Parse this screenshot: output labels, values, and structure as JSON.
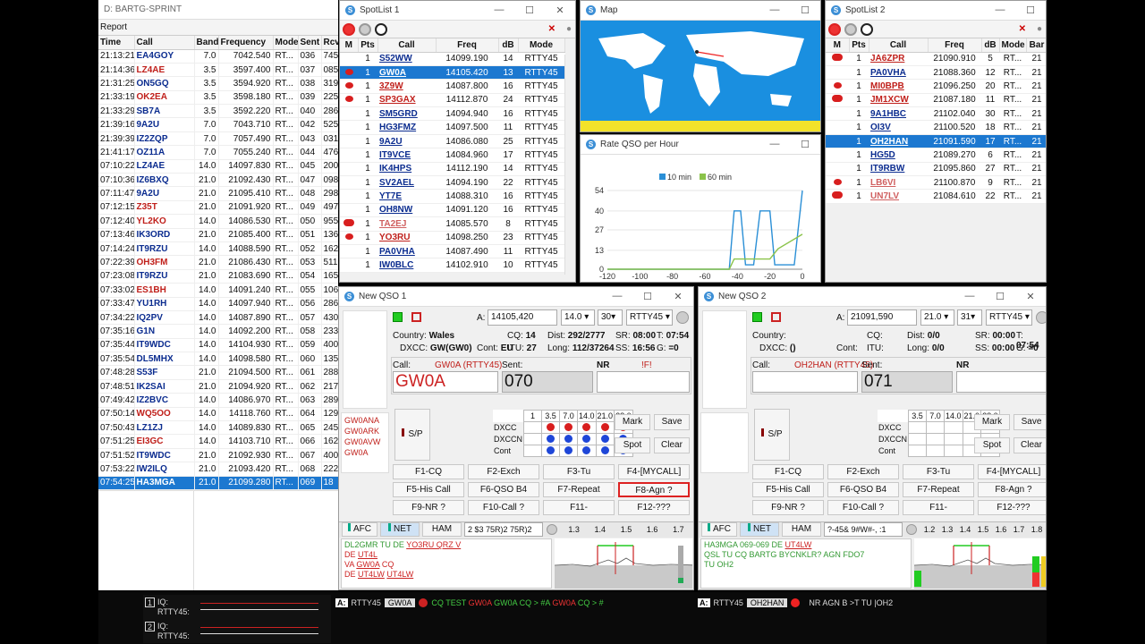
{
  "log": {
    "title": "D: BARTG-SPRINT",
    "menu": "Report",
    "headers": [
      "Time",
      "Call",
      "Band",
      "Frequency",
      "Mode",
      "Sent",
      "Rcv"
    ],
    "rows": [
      [
        "21:13:21",
        "EA4GOY",
        "7.0",
        "7042.540",
        "RT...",
        "036",
        "745",
        "b"
      ],
      [
        "21:14:36",
        "LZ4AE",
        "3.5",
        "3597.400",
        "RT...",
        "037",
        "085",
        "r"
      ],
      [
        "21:31:25",
        "ON5GQ",
        "3.5",
        "3594.920",
        "RT...",
        "038",
        "319",
        "b"
      ],
      [
        "21:33:19",
        "OK2EA",
        "3.5",
        "3598.180",
        "RT...",
        "039",
        "225",
        "r"
      ],
      [
        "21:33:29",
        "SB7A",
        "3.5",
        "3592.220",
        "RT...",
        "040",
        "286",
        "b"
      ],
      [
        "21:39:16",
        "9A2U",
        "7.0",
        "7043.710",
        "RT...",
        "042",
        "525",
        "b"
      ],
      [
        "21:39:39",
        "IZ2ZQP",
        "7.0",
        "7057.490",
        "RT...",
        "043",
        "031",
        "b"
      ],
      [
        "21:41:17",
        "OZ11A",
        "7.0",
        "7055.240",
        "RT...",
        "044",
        "476",
        "b"
      ],
      [
        "07:10:22",
        "LZ4AE",
        "14.0",
        "14097.830",
        "RT...",
        "045",
        "200",
        "b"
      ],
      [
        "07:10:36",
        "IZ6BXQ",
        "21.0",
        "21092.430",
        "RT...",
        "047",
        "098",
        "b"
      ],
      [
        "07:11:47",
        "9A2U",
        "21.0",
        "21095.410",
        "RT...",
        "048",
        "298",
        "b"
      ],
      [
        "07:12:15",
        "Z35T",
        "21.0",
        "21091.920",
        "RT...",
        "049",
        "497",
        "r"
      ],
      [
        "07:12:40",
        "YL2KO",
        "14.0",
        "14086.530",
        "RT...",
        "050",
        "955",
        "r"
      ],
      [
        "07:13:46",
        "IK3ORD",
        "21.0",
        "21085.400",
        "RT...",
        "051",
        "136",
        "b"
      ],
      [
        "07:14:24",
        "IT9RZU",
        "14.0",
        "14088.590",
        "RT...",
        "052",
        "162",
        "b"
      ],
      [
        "07:22:39",
        "OH3FM",
        "21.0",
        "21086.430",
        "RT...",
        "053",
        "511",
        "r"
      ],
      [
        "07:23:08",
        "IT9RZU",
        "21.0",
        "21083.690",
        "RT...",
        "054",
        "165",
        "b"
      ],
      [
        "07:33:02",
        "ES1BH",
        "14.0",
        "14091.240",
        "RT...",
        "055",
        "106",
        "r"
      ],
      [
        "07:33:47",
        "YU1RH",
        "14.0",
        "14097.940",
        "RT...",
        "056",
        "286",
        "b"
      ],
      [
        "07:34:22",
        "IQ2PV",
        "14.0",
        "14087.890",
        "RT...",
        "057",
        "430",
        "b"
      ],
      [
        "07:35:16",
        "G1N",
        "14.0",
        "14092.200",
        "RT...",
        "058",
        "233",
        "b"
      ],
      [
        "07:35:44",
        "IT9WDC",
        "14.0",
        "14104.930",
        "RT...",
        "059",
        "400",
        "b"
      ],
      [
        "07:35:54",
        "DL5MHX",
        "14.0",
        "14098.580",
        "RT...",
        "060",
        "135",
        "b"
      ],
      [
        "07:48:28",
        "S53F",
        "21.0",
        "21094.500",
        "RT...",
        "061",
        "288",
        "b"
      ],
      [
        "07:48:51",
        "IK2SAI",
        "21.0",
        "21094.920",
        "RT...",
        "062",
        "217",
        "b"
      ],
      [
        "07:49:42",
        "IZ2BVC",
        "14.0",
        "14086.970",
        "RT...",
        "063",
        "289",
        "b"
      ],
      [
        "07:50:14",
        "WQ5OO",
        "14.0",
        "14118.760",
        "RT...",
        "064",
        "129",
        "r"
      ],
      [
        "07:50:43",
        "LZ1ZJ",
        "14.0",
        "14089.830",
        "RT...",
        "065",
        "245",
        "b"
      ],
      [
        "07:51:25",
        "EI3GC",
        "14.0",
        "14103.710",
        "RT...",
        "066",
        "162",
        "r"
      ],
      [
        "07:51:52",
        "IT9WDC",
        "21.0",
        "21092.930",
        "RT...",
        "067",
        "400",
        "b"
      ],
      [
        "07:53:22",
        "IW2ILQ",
        "21.0",
        "21093.420",
        "RT...",
        "068",
        "222",
        "b"
      ],
      [
        "07:54:25",
        "HA3MGA",
        "21.0",
        "21099.280",
        "RT...",
        "069",
        "18",
        "s"
      ]
    ]
  },
  "spot1": {
    "title": "SpotList 1",
    "headers": [
      "M",
      "Pts",
      "Call",
      "Freq",
      "dB",
      "Mode"
    ],
    "rows": [
      [
        "",
        "1",
        "S52WW",
        "14099.190",
        "14",
        "RTTY45",
        "b"
      ],
      [
        "dot",
        "1",
        "GW0A",
        "14105.420",
        "13",
        "RTTY45",
        "s"
      ],
      [
        "dot",
        "1",
        "3Z9W",
        "14087.800",
        "16",
        "RTTY45",
        "r"
      ],
      [
        "dot",
        "1",
        "SP3GAX",
        "14112.870",
        "24",
        "RTTY45",
        "r"
      ],
      [
        "",
        "1",
        "SM5GRD",
        "14094.940",
        "16",
        "RTTY45",
        "b"
      ],
      [
        "",
        "1",
        "HG3FMZ",
        "14097.500",
        "11",
        "RTTY45",
        "b"
      ],
      [
        "",
        "1",
        "9A2U",
        "14086.080",
        "25",
        "RTTY45",
        "b"
      ],
      [
        "",
        "1",
        "IT9VCE",
        "14084.960",
        "17",
        "RTTY45",
        "b"
      ],
      [
        "",
        "1",
        "IK4HPS",
        "14112.190",
        "14",
        "RTTY45",
        "b"
      ],
      [
        "",
        "1",
        "SV2AEL",
        "14094.190",
        "22",
        "RTTY45",
        "b"
      ],
      [
        "",
        "1",
        "YT7E",
        "14088.310",
        "16",
        "RTTY45",
        "b"
      ],
      [
        "",
        "1",
        "OH8NW",
        "14091.120",
        "16",
        "RTTY45",
        "b"
      ],
      [
        "dot2",
        "1",
        "TA2EJ",
        "14085.570",
        "8",
        "RTTY45",
        "p"
      ],
      [
        "dot",
        "1",
        "YO3RU",
        "14098.250",
        "23",
        "RTTY45",
        "r"
      ],
      [
        "",
        "1",
        "PA0VHA",
        "14087.490",
        "11",
        "RTTY45",
        "b"
      ],
      [
        "",
        "1",
        "IW0BLC",
        "14102.910",
        "10",
        "RTTY45",
        "b"
      ]
    ]
  },
  "spot2": {
    "title": "SpotList 2",
    "headers": [
      "M",
      "Pts",
      "Call",
      "Freq",
      "dB",
      "Mode",
      "Bar"
    ],
    "rows": [
      [
        "dot2",
        "1",
        "JA6ZPR",
        "21090.910",
        "5",
        "RT...",
        "21",
        "r"
      ],
      [
        "",
        "1",
        "PA0VHA",
        "21088.360",
        "12",
        "RT...",
        "21",
        "b"
      ],
      [
        "dot",
        "1",
        "MI0BPB",
        "21096.250",
        "20",
        "RT...",
        "21",
        "r"
      ],
      [
        "dot2",
        "1",
        "JM1XCW",
        "21087.180",
        "11",
        "RT...",
        "21",
        "r"
      ],
      [
        "",
        "1",
        "9A1HBC",
        "21102.040",
        "30",
        "RT...",
        "21",
        "b"
      ],
      [
        "",
        "1",
        "OI3V",
        "21100.520",
        "18",
        "RT...",
        "21",
        "b"
      ],
      [
        "",
        "1",
        "OH2HAN",
        "21091.590",
        "17",
        "RT...",
        "21",
        "s"
      ],
      [
        "",
        "1",
        "HG5D",
        "21089.270",
        "6",
        "RT...",
        "21",
        "b"
      ],
      [
        "",
        "1",
        "IT9RBW",
        "21095.860",
        "27",
        "RT...",
        "21",
        "b"
      ],
      [
        "dot",
        "1",
        "LB6VI",
        "21100.870",
        "9",
        "RT...",
        "21",
        "p"
      ],
      [
        "dot2",
        "1",
        "UN7LV",
        "21084.610",
        "22",
        "RT...",
        "21",
        "p"
      ]
    ]
  },
  "map": {
    "title": "Map"
  },
  "rate": {
    "title": "Rate QSO per Hour",
    "legend": [
      "10 min",
      "60 min"
    ],
    "chart_data": {
      "type": "line",
      "x": [
        -120,
        -100,
        -80,
        -60,
        -40,
        -20,
        0
      ],
      "ylim": [
        0,
        54
      ],
      "yticks": [
        0,
        13,
        27,
        40,
        54
      ],
      "series": [
        {
          "name": "10 min",
          "color": "#2a8fd6",
          "points": [
            [
              -120,
              0
            ],
            [
              -45,
              0
            ],
            [
              -42,
              40
            ],
            [
              -38,
              40
            ],
            [
              -35,
              3
            ],
            [
              -30,
              3
            ],
            [
              -26,
              40
            ],
            [
              -20,
              40
            ],
            [
              -17,
              3
            ],
            [
              -5,
              3
            ],
            [
              0,
              54
            ]
          ]
        },
        {
          "name": "60 min",
          "color": "#8bc34a",
          "points": [
            [
              -120,
              0
            ],
            [
              -45,
              0
            ],
            [
              -42,
              7
            ],
            [
              -20,
              7
            ],
            [
              -15,
              14
            ],
            [
              0,
              24
            ]
          ]
        }
      ]
    }
  },
  "qso1": {
    "title": "New QSO 1",
    "a": "A:",
    "freq": "14105,420",
    "band": "14.0",
    "num": "30",
    "mode": "RTTY45",
    "country": "Wales",
    "cq": "14",
    "dist": "292/2777",
    "sr": "08:00",
    "t": "07:54",
    "dxcc": "GW(GW0)",
    "cont": "EU",
    "itu": "27",
    "long": "112/37264",
    "ss": "16:56",
    "g": "=0",
    "call_label": "Call:",
    "call_info": "GW0A (RTTY45)",
    "sent_label": "Sent:",
    "nr_label": "NR",
    "nr_flag": "!F!",
    "call": "GW0A",
    "sent": "070",
    "nr": "",
    "partials": [
      "GW0ANA",
      "GW0ARK",
      "GW0AVW",
      "GW0A"
    ],
    "sp": "S/P",
    "grid_bands": [
      "1",
      "3.5",
      "7.0",
      "14.0",
      "21.0",
      "28.0"
    ],
    "grid_rows": [
      "DXCC",
      "DXCCN",
      "Cont"
    ],
    "mark": "Mark",
    "save": "Save",
    "spot": "Spot",
    "clear": "Clear",
    "fkeys": [
      "F1-CQ",
      "F2-Exch",
      "F3-Tu",
      "F4-[MYCALL]",
      "F5-His Call",
      "F6-QSO B4",
      "F7-Repeat",
      "F8-Agn ?",
      "F9-NR ?",
      "F10-Call ?",
      "F11-",
      "F12-???"
    ],
    "afc": "AFC",
    "net": "NET",
    "ham": "HAM",
    "rxline": "2 $3 75R)2 75R)2",
    "scale": [
      "1.3",
      "1.4",
      "1.5",
      "1.6",
      "1.7"
    ],
    "rx_text": [
      [
        "DL2GMR TU DE ",
        "YO3RU QRZ V"
      ],
      [
        "DE ",
        "UT4L"
      ],
      [
        "VA ",
        "GW0A",
        " CQ"
      ],
      [
        "DE ",
        "UT4LW",
        " ",
        "UT4LW"
      ]
    ]
  },
  "qso2": {
    "title": "New QSO 2",
    "a": "A:",
    "freq": "21091,590",
    "band": "21.0",
    "num": "31",
    "mode": "RTTY45",
    "country": "",
    "cq": "",
    "dist": "0/0",
    "sr": "00:00",
    "t": "07:54",
    "dxcc": "()",
    "cont": "",
    "itu": "",
    "long": "0/0",
    "ss": "00:00",
    "g": "=0",
    "call_label": "Call:",
    "call_info": "OH2HAN (RTTY45)",
    "sent_label": "Sent:",
    "nr_label": "NR",
    "call": "",
    "sent": "071",
    "nr": "",
    "sp": "S/P",
    "grid_bands": [
      "3.5",
      "7.0",
      "14.0",
      "21.0",
      "28.0"
    ],
    "grid_rows": [
      "DXCC",
      "DXCCN",
      "Cont"
    ],
    "mark": "Mark",
    "save": "Save",
    "spot": "Spot",
    "clear": "Clear",
    "fkeys": [
      "F1-CQ",
      "F2-Exch",
      "F3-Tu",
      "F4-[MYCALL]",
      "F5-His Call",
      "F6-QSO B4",
      "F7-Repeat",
      "F8-Agn ?",
      "F9-NR ?",
      "F10-Call ?",
      "F11-",
      "F12-???"
    ],
    "afc": "AFC",
    "net": "NET",
    "ham": "HAM",
    "rxline": "?-45& 9#W#-, :1",
    "scale": [
      "1.2",
      "1.3",
      "1.4",
      "1.5",
      "1.6",
      "1.7",
      "1.8"
    ],
    "rx_text": [
      [
        "HA3MGA 069-069 DE ",
        "UT4LW"
      ],
      [
        "QSL TU CQ BARTG BYCNKLR? AGN    FDO7"
      ],
      [
        "TU OH2"
      ]
    ]
  },
  "iq": [
    {
      "n": "1",
      "l1": "IQ:",
      "l2": "RTTY45:"
    },
    {
      "n": "2",
      "l1": "IQ:",
      "l2": "RTTY45:"
    }
  ],
  "status1": {
    "a": "A:",
    "mode": "RTTY45",
    "call": "GW0A",
    "text_pre": "CQ TEST ",
    "c1": "GW0A",
    "mid": " GW0A CQ > #A ",
    "c2": "GW0A",
    "end": " CQ > #"
  },
  "status2": {
    "a": "A:",
    "mode": "RTTY45",
    "call": "OH2HAN",
    "text": "NR AGN B >T TU |OH2"
  }
}
